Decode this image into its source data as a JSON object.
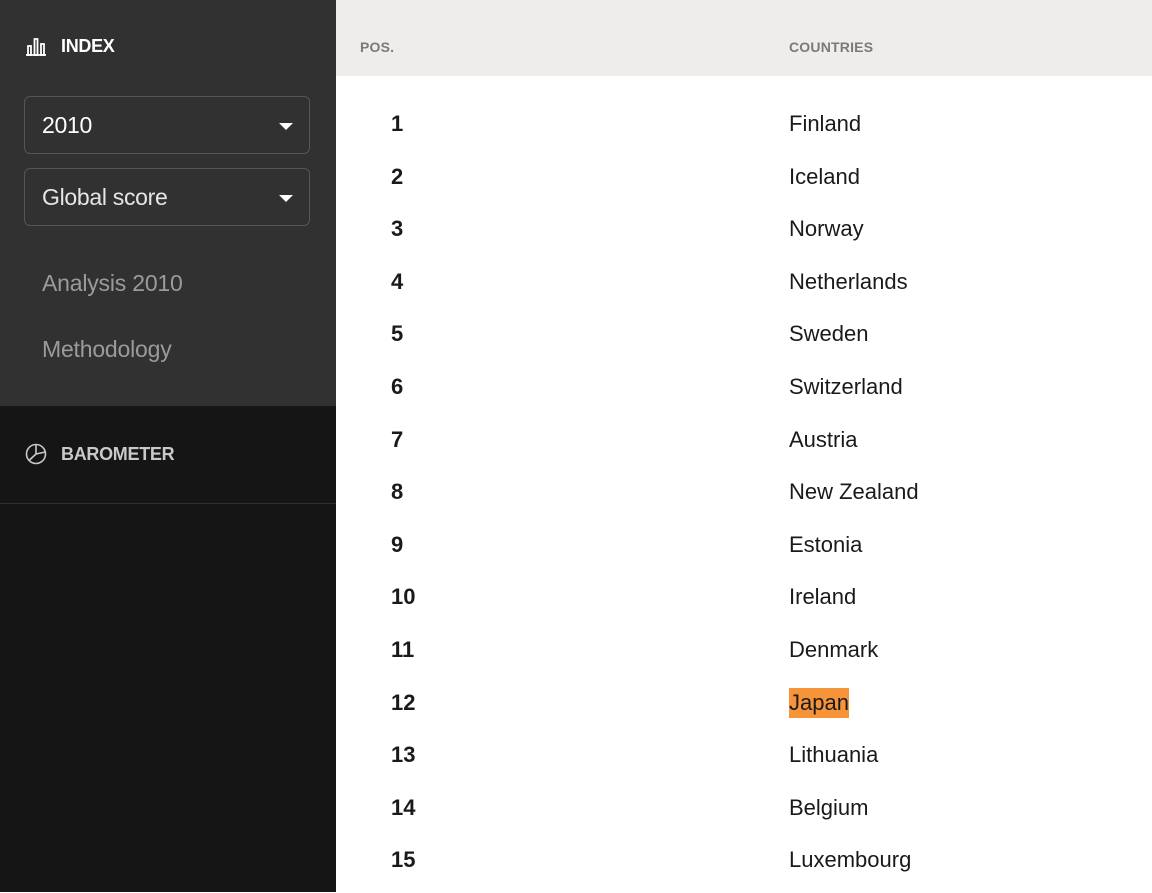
{
  "sidebar": {
    "index": {
      "label": "INDEX",
      "icon": "bar-chart-icon"
    },
    "year_select": {
      "value": "2010"
    },
    "metric_select": {
      "value": "Global score"
    },
    "links": {
      "analysis": "Analysis 2010",
      "methodology": "Methodology"
    },
    "barometer": {
      "label": "BAROMETER",
      "icon": "pie-chart-icon"
    }
  },
  "table": {
    "headers": {
      "pos": "POS.",
      "countries": "COUNTRIES"
    },
    "highlight_color": "#f7943a",
    "rows": [
      {
        "pos": "1",
        "country": "Finland"
      },
      {
        "pos": "2",
        "country": "Iceland"
      },
      {
        "pos": "3",
        "country": "Norway"
      },
      {
        "pos": "4",
        "country": "Netherlands"
      },
      {
        "pos": "5",
        "country": "Sweden"
      },
      {
        "pos": "6",
        "country": "Switzerland"
      },
      {
        "pos": "7",
        "country": "Austria"
      },
      {
        "pos": "8",
        "country": "New Zealand"
      },
      {
        "pos": "9",
        "country": "Estonia"
      },
      {
        "pos": "10",
        "country": "Ireland"
      },
      {
        "pos": "11",
        "country": "Denmark"
      },
      {
        "pos": "12",
        "country": "Japan",
        "highlighted": true
      },
      {
        "pos": "13",
        "country": "Lithuania"
      },
      {
        "pos": "14",
        "country": "Belgium"
      },
      {
        "pos": "15",
        "country": "Luxembourg"
      }
    ]
  }
}
